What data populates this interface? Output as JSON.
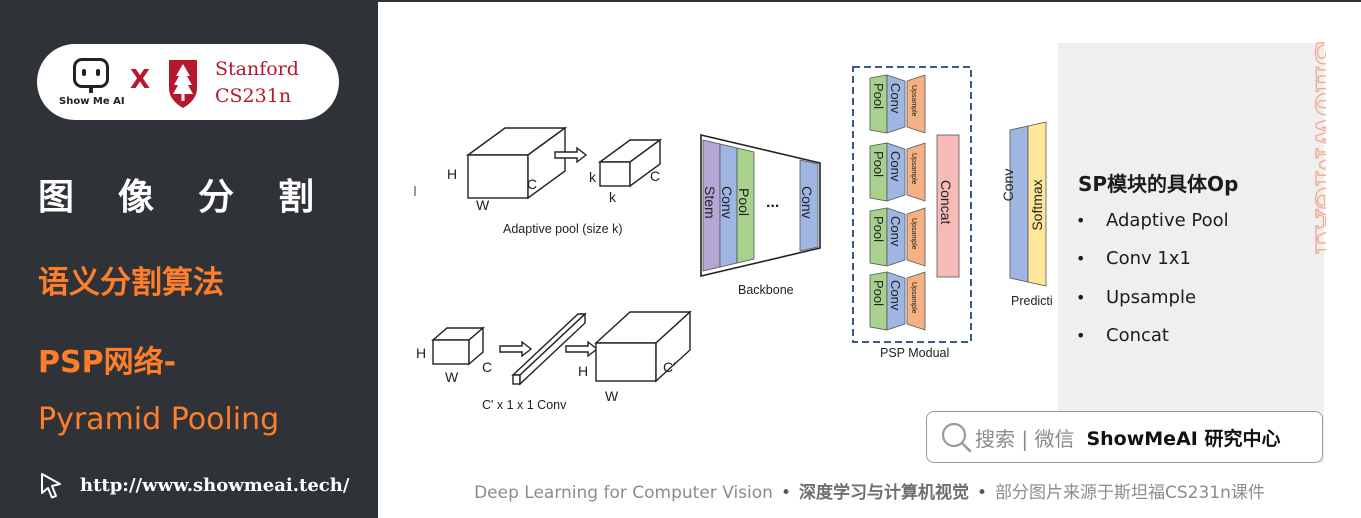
{
  "sidebar": {
    "logo": {
      "brand_text": "Show Me AI",
      "x_mark": "X",
      "partner_line1": "Stanford",
      "partner_line2": "CS231n"
    },
    "title": "图像分割",
    "subtitle": "语义分割算法",
    "topic_line1": "PSP网络-",
    "topic_line2": "Pyramid Pooling",
    "url": "http://www.showmeai.tech/"
  },
  "figure": {
    "adaptive_pool": {
      "label_h": "H",
      "label_w": "W",
      "label_c": "C",
      "label_k1": "k",
      "label_k2": "k",
      "label_c2": "C",
      "caption": "Adaptive pool (size k)"
    },
    "conv1x1": {
      "label_h": "H",
      "label_w": "W",
      "label_c": "C",
      "label_h2": "H",
      "label_w2": "W",
      "label_c2": "C'",
      "caption": "C' x 1 x 1  Conv"
    },
    "backbone": {
      "layers": [
        "Stem",
        "Conv",
        "Pool",
        "...",
        "Conv"
      ],
      "caption": "Backbone"
    },
    "psp_module": {
      "branches": [
        {
          "pool": "Pool",
          "conv": "Conv",
          "up": "Upsample"
        },
        {
          "pool": "Pool",
          "conv": "Conv",
          "up": "Upsample"
        },
        {
          "pool": "Pool",
          "conv": "Conv",
          "up": "Upsample"
        },
        {
          "pool": "Pool",
          "conv": "Conv",
          "up": "Upsample"
        }
      ],
      "concat": "Concat",
      "caption": "PSP Modual"
    },
    "prediction": {
      "conv": "Conv",
      "softmax": "Softmax",
      "caption": "Predicti"
    },
    "colors": {
      "stem": "#b4a7d6",
      "conv": "#9fb6e3",
      "pool": "#a9d18e",
      "upsample": "#f4b183",
      "concat": "#f8b9b9",
      "softmax": "#ffe699",
      "dashed_border": "#3a5a8c"
    }
  },
  "panel": {
    "watermark": "ShowMeAI",
    "title": "SP模块的具体Op",
    "ops": [
      "Adaptive Pool",
      "Conv 1x1",
      "Upsample",
      "Concat"
    ],
    "bullet": "•"
  },
  "search": {
    "text": "搜索 | 微信",
    "brand": "ShowMeAI 研究中心"
  },
  "footer": {
    "part1": "Deep Learning for Computer Vision",
    "sep": "•",
    "part2": "深度学习与计算机视觉",
    "part3": "部分图片来源于斯坦福CS231n课件"
  }
}
